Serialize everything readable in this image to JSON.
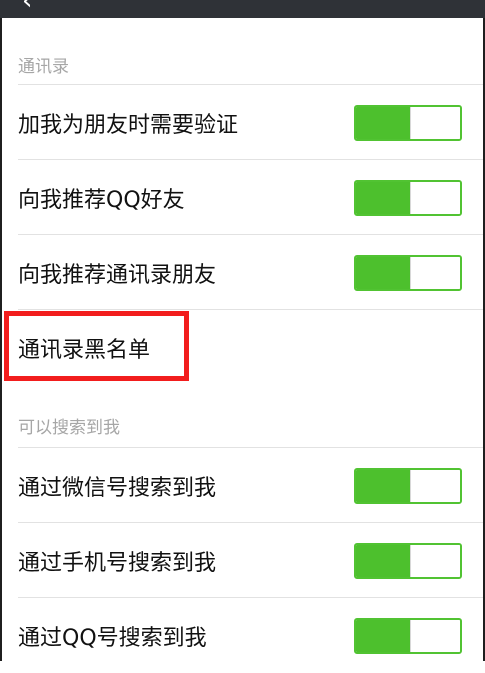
{
  "topbar": {
    "back_icon": "back-arrow-icon",
    "background": "#2f3237"
  },
  "sections": [
    {
      "header": "通讯录",
      "items": [
        {
          "label": "加我为朋友时需要验证",
          "toggle": true
        },
        {
          "label": "向我推荐QQ好友",
          "toggle": true
        },
        {
          "label": "向我推荐通讯录朋友",
          "toggle": true
        },
        {
          "label": "通讯录黑名单",
          "toggle": false
        }
      ]
    },
    {
      "header": "可以搜索到我",
      "items": [
        {
          "label": "通过微信号搜索到我",
          "toggle": true
        },
        {
          "label": "通过手机号搜索到我",
          "toggle": true
        },
        {
          "label": "通过QQ号搜索到我",
          "toggle": true
        }
      ]
    }
  ],
  "colors": {
    "toggle_on": "#4dc02d",
    "highlight": "#f21d1d",
    "header_text": "#a6a6a6"
  }
}
